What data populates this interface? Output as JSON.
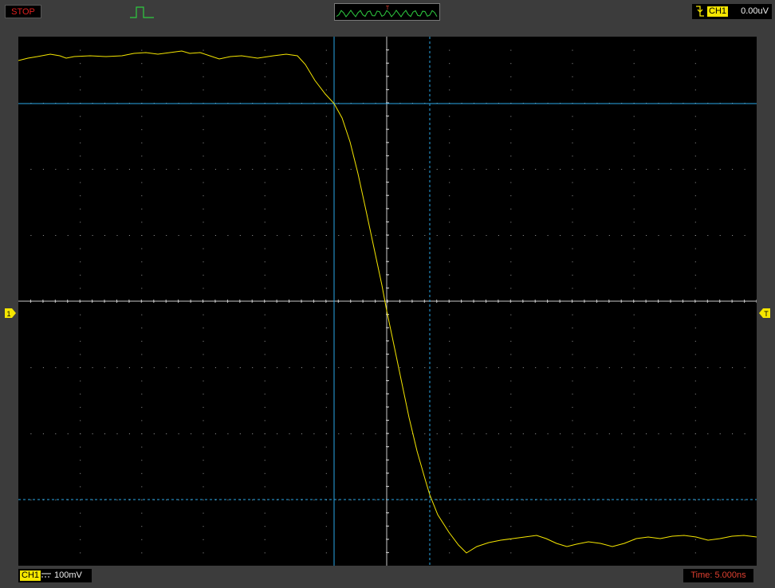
{
  "status": {
    "label": "STOP",
    "color": "#e02020"
  },
  "trigger": {
    "icon": "pulse-icon",
    "edge_icon": "falling-edge-icon",
    "channel": "CH1",
    "level": "0.00uV",
    "marker_label": "T"
  },
  "mini_wave": {
    "trigger_label": "T"
  },
  "channel": {
    "name": "CH1",
    "marker_label": "1",
    "coupling_icon": "dc-coupling-icon",
    "volts_per_div": "100mV",
    "color": "#f5e600"
  },
  "timebase": {
    "label": "Time: 5.000ns"
  },
  "cursors": {
    "color": "#2aa8e8"
  },
  "grid": {
    "h_divisions": 12,
    "v_divisions": 8
  }
}
